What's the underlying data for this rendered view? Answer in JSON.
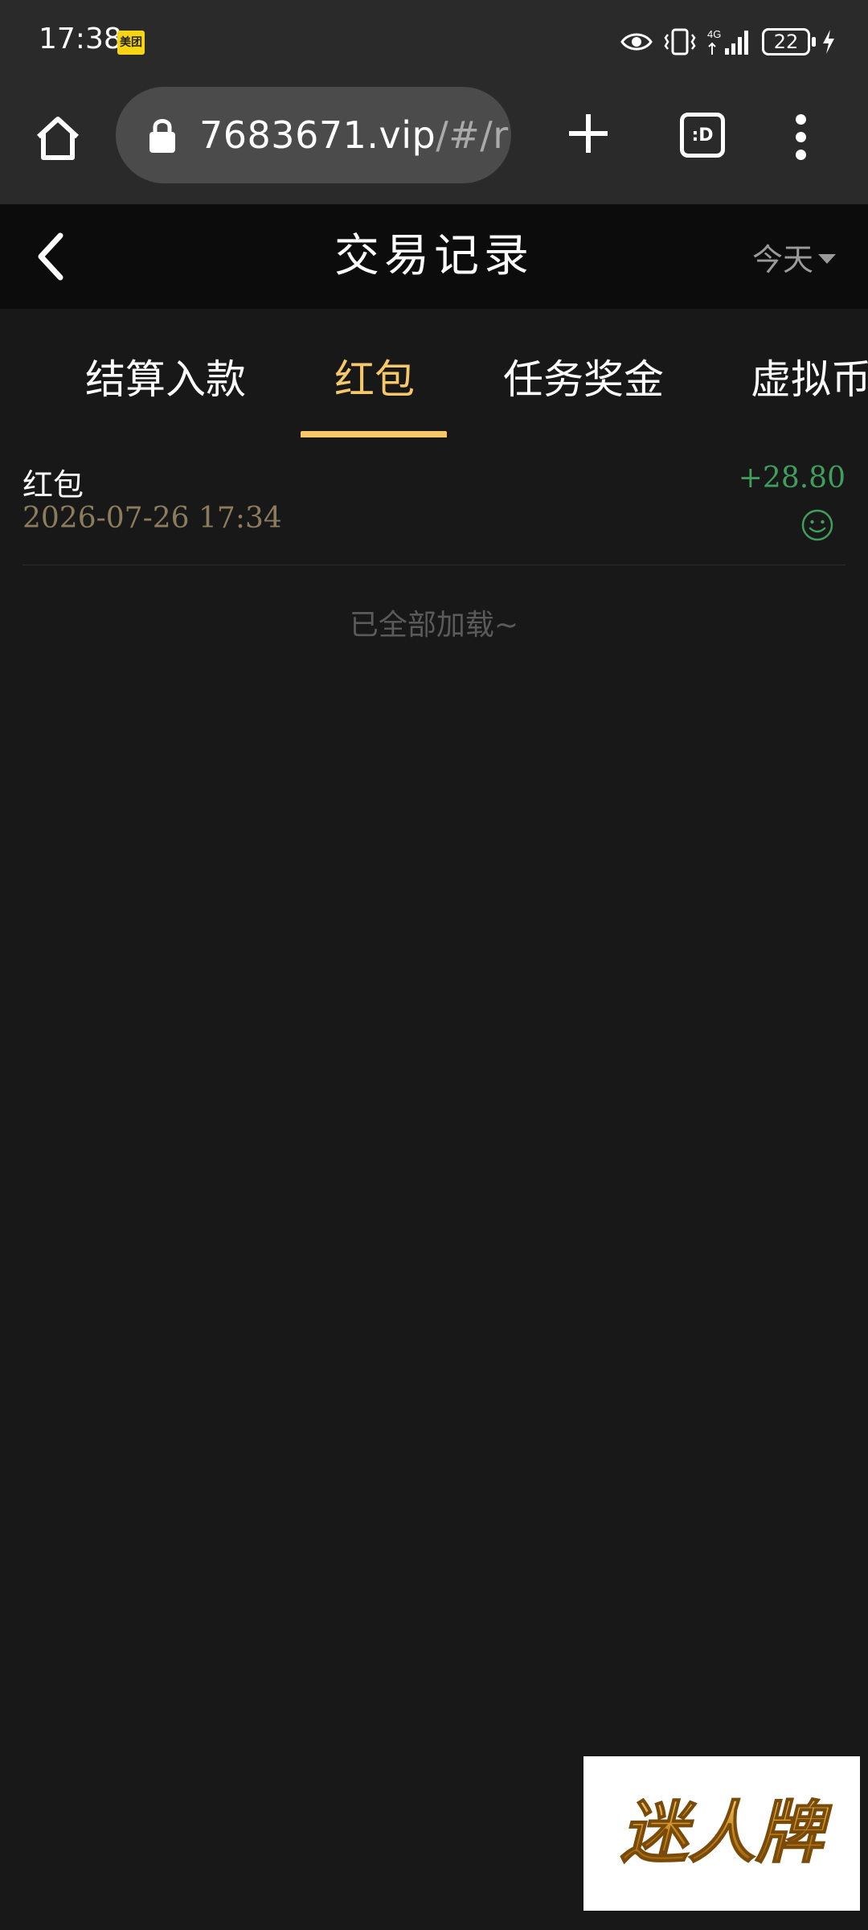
{
  "status_bar": {
    "time": "17:38",
    "app_badge": "美团",
    "network": "4G",
    "battery": "22"
  },
  "browser": {
    "url_main": "7683671.vip",
    "url_rest": "/#/r",
    "tabs_label": ":D"
  },
  "header": {
    "title": "交易记录",
    "date_filter": "今天"
  },
  "tabs": [
    {
      "label": "结算入款"
    },
    {
      "label": "红包"
    },
    {
      "label": "任务奖金"
    },
    {
      "label": "虚拟币"
    }
  ],
  "active_tab": "红包",
  "records": [
    {
      "title": "红包",
      "time": "2026-07-26 17:34",
      "amount": "+28.80"
    }
  ],
  "load_status": "已全部加载~",
  "logo_text": "迷人牌",
  "colors": {
    "accent": "#f6c86a",
    "amount_green": "#3f9e5c",
    "background": "#181818"
  }
}
